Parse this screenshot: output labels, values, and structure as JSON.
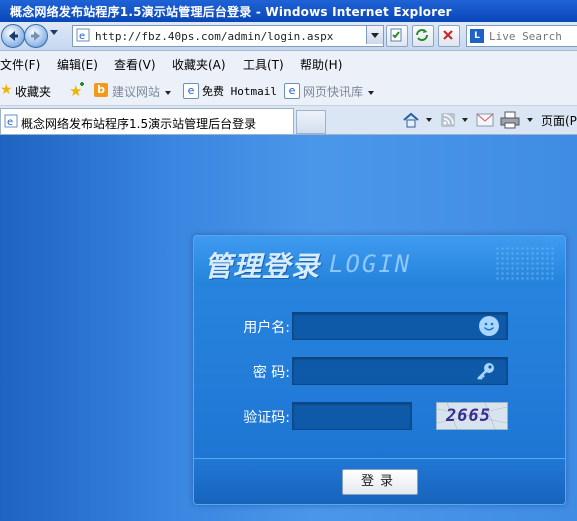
{
  "window": {
    "title": "概念网络发布站程序1.5演示站管理后台登录 - Windows Internet Explorer"
  },
  "address_bar": {
    "url": "http://fbz.40ps.com/admin/login.aspx"
  },
  "search": {
    "placeholder": "Live Search"
  },
  "menu": {
    "items": [
      "文件(F)",
      "编辑(E)",
      "查看(V)",
      "收藏夹(A)",
      "工具(T)",
      "帮助(H)"
    ]
  },
  "favorites_bar": {
    "favorites_label": "收藏夹",
    "suggested_sites": "建议网站",
    "hotmail": "免费 Hotmail",
    "web_slice": "网页快讯库"
  },
  "tab": {
    "title": "概念网络发布站程序1.5演示站管理后台登录"
  },
  "command_bar": {
    "page_label": "页面(P)"
  },
  "login": {
    "heading_cn": "管理登录",
    "heading_en": "LOGIN",
    "username_label": "用户名:",
    "password_label": "密  码:",
    "captcha_label": "验证码:",
    "username_value": "",
    "password_value": "",
    "captcha_value": "",
    "captcha_code": "2665",
    "submit_label": "登录"
  },
  "colors": {
    "page_bg": "#3a86e0",
    "panel_bg": "#1c72d0",
    "field_bg": "#0e5aa8"
  }
}
